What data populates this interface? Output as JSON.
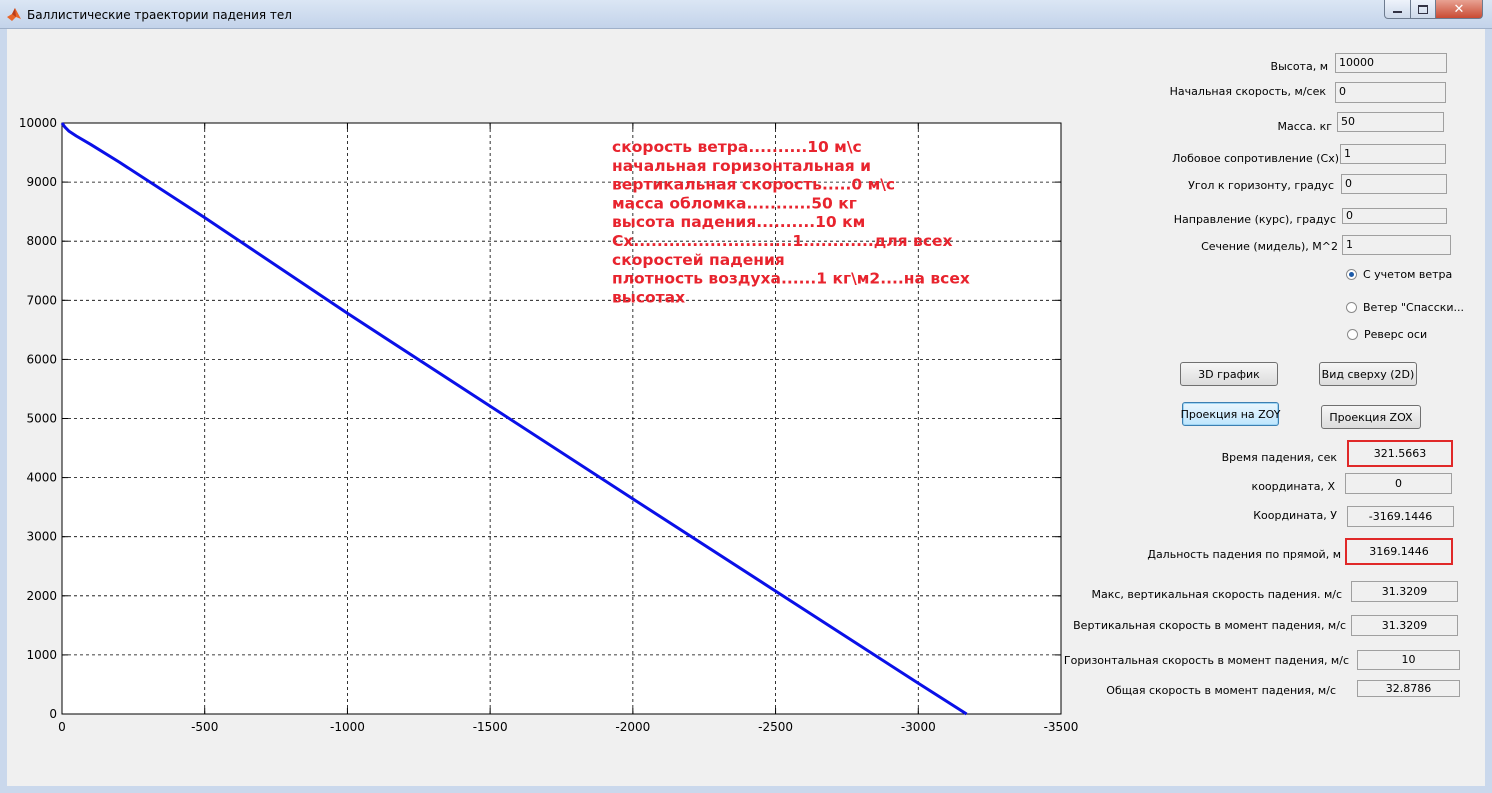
{
  "window": {
    "title": "Баллистические траектории падения тел",
    "close_glyph": "✕"
  },
  "inputs": [
    {
      "label": "Высота, м",
      "value": "10000"
    },
    {
      "label": "Начальная скорость, м/сек",
      "value": "0"
    },
    {
      "label": "Масса. кг",
      "value": "50"
    },
    {
      "label": "Лобовое сопротивление (Cx)",
      "value": "1"
    },
    {
      "label": "Угол к горизонту, градус",
      "value": "0"
    },
    {
      "label": "Направление  (курс), градус",
      "value": "0"
    },
    {
      "label": "Сечение (мидель), М^2",
      "value": "1"
    }
  ],
  "radios": [
    {
      "label": "С учетом ветра",
      "checked": true
    },
    {
      "label": "Ветер \"Спасски...",
      "checked": false
    },
    {
      "label": "Реверс оси",
      "checked": false
    }
  ],
  "buttons": {
    "plot3d": "3D график",
    "topview": "Вид сверху (2D)",
    "zoy": "Проекция на ZOY",
    "zox": "Проекция ZOX"
  },
  "outputs": [
    {
      "label": "Время падения, сек",
      "value": "321.5663",
      "highlight": true
    },
    {
      "label": "координата, X",
      "value": "0",
      "highlight": false
    },
    {
      "label": "Координата, У",
      "value": "-3169.1446",
      "highlight": false
    },
    {
      "label": "Дальность падения по прямой, м",
      "value": "3169.1446",
      "highlight": true
    },
    {
      "label": "Макс,  вертикальная скорость падения. м/с",
      "value": "31.3209",
      "highlight": false
    },
    {
      "label": "Вертикальная  скорость в момент падения, м/с",
      "value": "31.3209",
      "highlight": false
    },
    {
      "label": "Горизонтальная скорость в момент падения, м/с",
      "value": "10",
      "highlight": false
    },
    {
      "label": "Общая скорость в момент падения, м/с",
      "value": "32.8786",
      "highlight": false
    }
  ],
  "chart_data": {
    "type": "line",
    "x_ticks": [
      "0",
      "-500",
      "-1000",
      "-1500",
      "-2000",
      "-2500",
      "-3000",
      "-3500"
    ],
    "y_ticks": [
      "0",
      "1000",
      "2000",
      "3000",
      "4000",
      "5000",
      "6000",
      "7000",
      "8000",
      "9000",
      "10000"
    ],
    "xlim": [
      0,
      -3500
    ],
    "ylim": [
      0,
      10000
    ],
    "x_reversed": true,
    "grid": true,
    "line_color": "#0a10e8",
    "series": [
      {
        "x": [
          0,
          -10,
          -25,
          -50,
          -100,
          -200,
          -500,
          -1000,
          -1500,
          -2000,
          -2500,
          -3000,
          -3169.1446
        ],
        "y": [
          10000,
          9930,
          9860,
          9780,
          9640,
          9340,
          8400,
          6780,
          5210,
          3640,
          2080,
          520,
          0
        ]
      }
    ],
    "annotation": [
      "скорость ветра..........10 м\\с",
      "начальная горизонтальная и",
      "вертикальная скорость.....0 м\\с",
      "масса обломка...........50 кг",
      "высота падения..........10 км",
      "Сх...........................1............для всех",
      "скоростей падения",
      "плотность воздуха......1 кг\\м2....на всех",
      "высотах"
    ]
  }
}
